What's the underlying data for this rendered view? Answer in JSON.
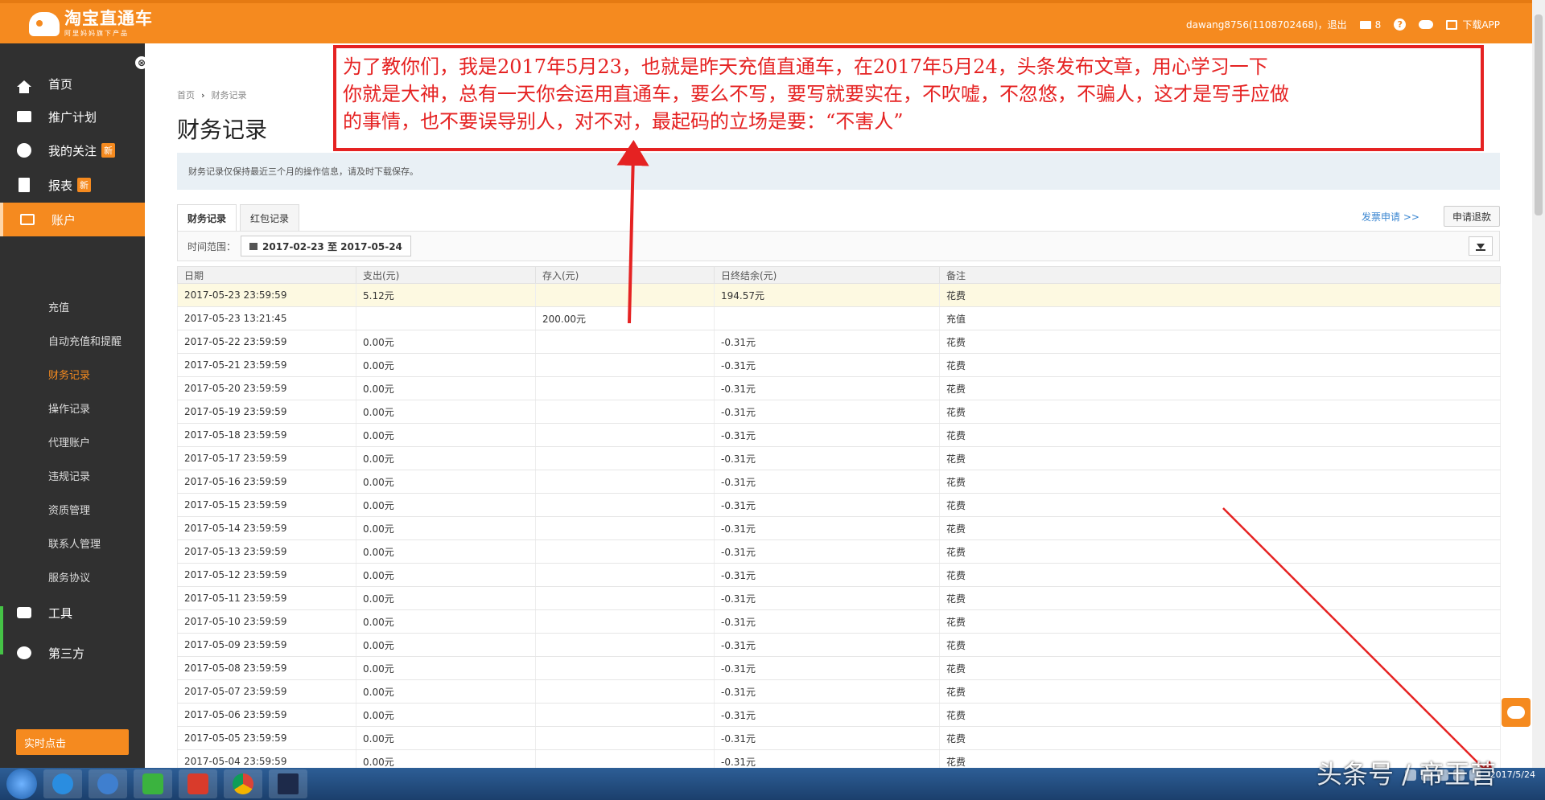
{
  "header": {
    "logo_title": "淘宝直通车",
    "logo_sub": "阿里妈妈旗下产品",
    "user": "dawang8756(1108702468)，退出",
    "messages": "8",
    "help": "?",
    "download_app": "下载APP"
  },
  "sidebar": {
    "collapse": "⊗",
    "items": [
      {
        "label": "首页"
      },
      {
        "label": "推广计划"
      },
      {
        "label": "我的关注",
        "badge": "新"
      },
      {
        "label": "报表",
        "badge": "新"
      },
      {
        "label": "账户"
      },
      {
        "label": "工具"
      },
      {
        "label": "第三方"
      }
    ],
    "sub_items": [
      "充值",
      "自动充值和提醒",
      "财务记录",
      "操作记录",
      "代理账户",
      "违规记录",
      "资质管理",
      "联系人管理",
      "服务协议"
    ],
    "realtime": "实时点击"
  },
  "main": {
    "breadcrumb_home": "首页",
    "breadcrumb_sep": "›",
    "breadcrumb_current": "财务记录",
    "title": "财务记录",
    "notice": "财务记录仅保持最近三个月的操作信息，请及时下载保存。",
    "tabs": [
      "财务记录",
      "红包记录"
    ],
    "invoice": "发票申请 >>",
    "refund": "申请退款",
    "time_label": "时间范围：",
    "date_range": "2017-02-23 至 2017-05-24",
    "columns": [
      "日期",
      "支出(元)",
      "存入(元)",
      "日终结余(元)",
      "备注"
    ],
    "rows": [
      [
        "2017-05-23 23:59:59",
        "5.12元",
        "",
        "194.57元",
        "花费"
      ],
      [
        "2017-05-23 13:21:45",
        "",
        "200.00元",
        "",
        "充值"
      ],
      [
        "2017-05-22 23:59:59",
        "0.00元",
        "",
        "-0.31元",
        "花费"
      ],
      [
        "2017-05-21 23:59:59",
        "0.00元",
        "",
        "-0.31元",
        "花费"
      ],
      [
        "2017-05-20 23:59:59",
        "0.00元",
        "",
        "-0.31元",
        "花费"
      ],
      [
        "2017-05-19 23:59:59",
        "0.00元",
        "",
        "-0.31元",
        "花费"
      ],
      [
        "2017-05-18 23:59:59",
        "0.00元",
        "",
        "-0.31元",
        "花费"
      ],
      [
        "2017-05-17 23:59:59",
        "0.00元",
        "",
        "-0.31元",
        "花费"
      ],
      [
        "2017-05-16 23:59:59",
        "0.00元",
        "",
        "-0.31元",
        "花费"
      ],
      [
        "2017-05-15 23:59:59",
        "0.00元",
        "",
        "-0.31元",
        "花费"
      ],
      [
        "2017-05-14 23:59:59",
        "0.00元",
        "",
        "-0.31元",
        "花费"
      ],
      [
        "2017-05-13 23:59:59",
        "0.00元",
        "",
        "-0.31元",
        "花费"
      ],
      [
        "2017-05-12 23:59:59",
        "0.00元",
        "",
        "-0.31元",
        "花费"
      ],
      [
        "2017-05-11 23:59:59",
        "0.00元",
        "",
        "-0.31元",
        "花费"
      ],
      [
        "2017-05-10 23:59:59",
        "0.00元",
        "",
        "-0.31元",
        "花费"
      ],
      [
        "2017-05-09 23:59:59",
        "0.00元",
        "",
        "-0.31元",
        "花费"
      ],
      [
        "2017-05-08 23:59:59",
        "0.00元",
        "",
        "-0.31元",
        "花费"
      ],
      [
        "2017-05-07 23:59:59",
        "0.00元",
        "",
        "-0.31元",
        "花费"
      ],
      [
        "2017-05-06 23:59:59",
        "0.00元",
        "",
        "-0.31元",
        "花费"
      ],
      [
        "2017-05-05 23:59:59",
        "0.00元",
        "",
        "-0.31元",
        "花费"
      ],
      [
        "2017-05-04 23:59:59",
        "0.00元",
        "",
        "-0.31元",
        "花费"
      ]
    ]
  },
  "annotation": {
    "line1": "为了教你们，我是2017年5月23，也就是昨天充值直通车，在2017年5月24，头条发布文章，用心学习一下",
    "line2": "你就是大神，总有一天你会运用直通车，要么不写，要写就要实在，不吹嘘，不忽悠，不骗人，这才是写手应做",
    "line3": "的事情，也不要误导别人，对不对，最起码的立场是要：“不害人”"
  },
  "taskbar": {
    "clock": "2017/5/24",
    "watermark": "头条号 / 帝王营"
  },
  "colors": {
    "brand_orange": "#f58a1f",
    "sidebar_bg": "#303030",
    "annotation_red": "#e52222",
    "link_blue": "#3a86d1"
  }
}
